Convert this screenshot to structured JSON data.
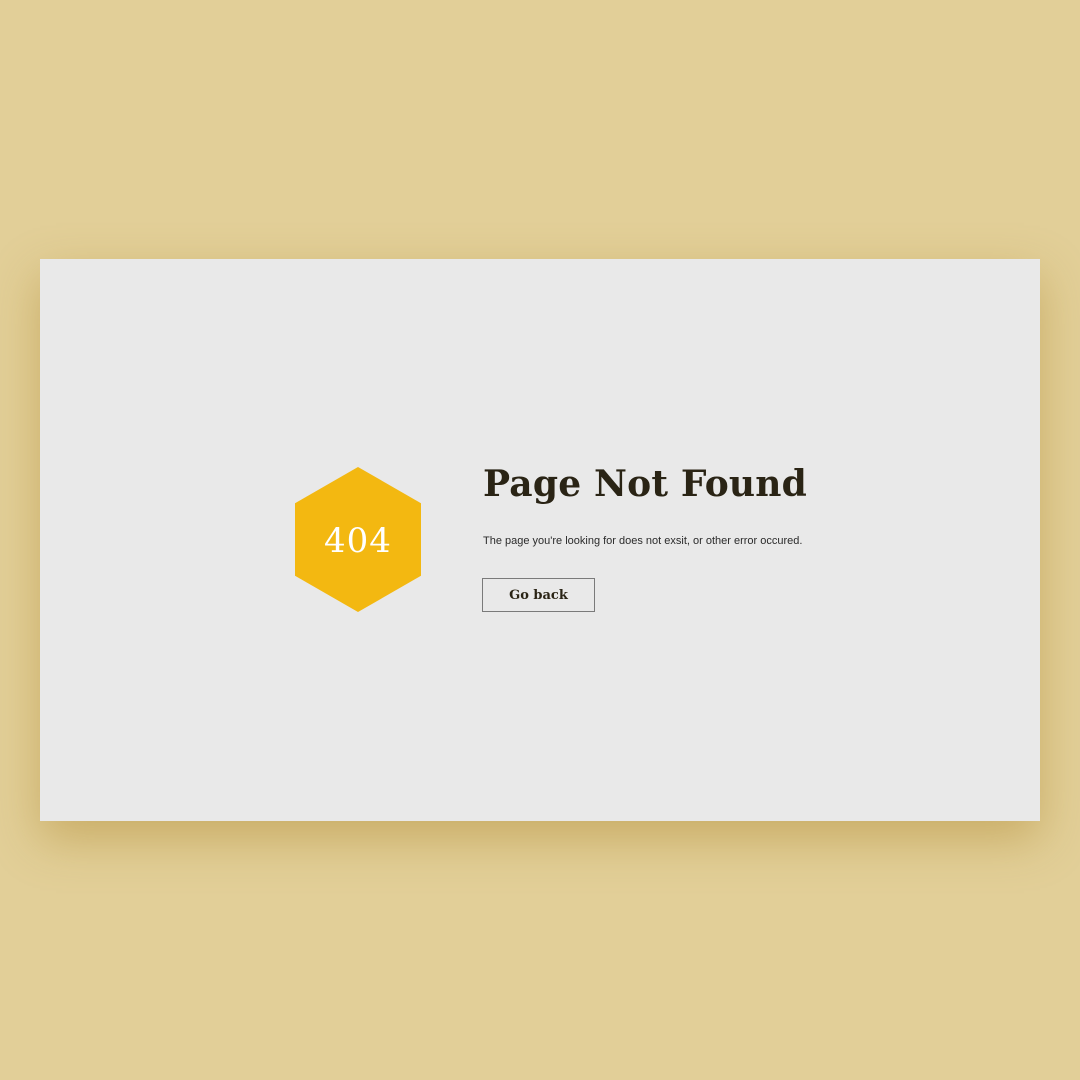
{
  "error": {
    "code": "404",
    "title": "Page Not Found",
    "message": "The page you're looking for does not exsit, or other error occured.",
    "button_label": "Go back"
  },
  "colors": {
    "background": "#e2cf98",
    "card": "#e9e9e9",
    "accent": "#f3b811",
    "text": "#2a2415"
  }
}
